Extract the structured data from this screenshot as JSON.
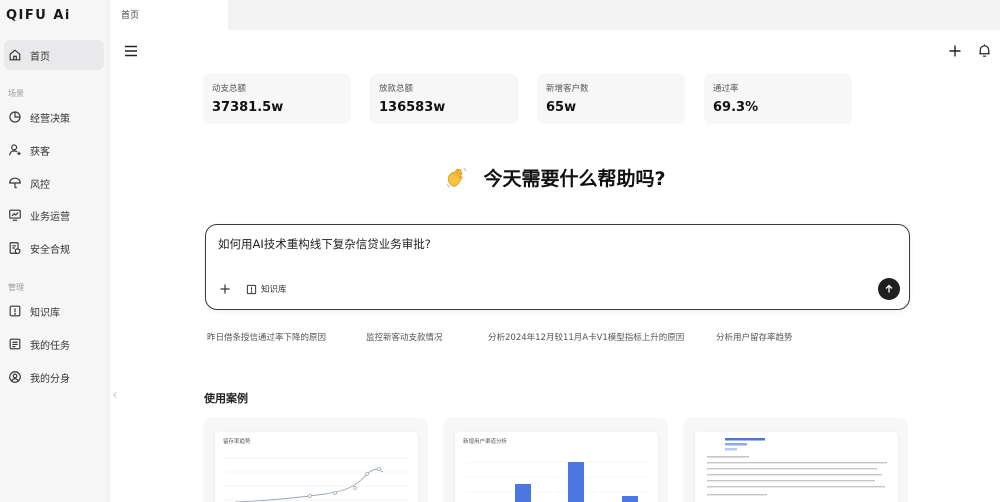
{
  "app": {
    "logo": "QIFU Ai"
  },
  "sidebar": {
    "home": "首页",
    "section_scene": "场景",
    "section_manage": "管理",
    "items_scene": [
      {
        "label": "经营决策",
        "icon": "pie-chart-icon"
      },
      {
        "label": "获客",
        "icon": "user-add-icon"
      },
      {
        "label": "风控",
        "icon": "umbrella-icon"
      },
      {
        "label": "业务运营",
        "icon": "monitor-chart-icon"
      },
      {
        "label": "安全合规",
        "icon": "shield-doc-icon"
      }
    ],
    "items_manage": [
      {
        "label": "知识库",
        "icon": "book-icon"
      },
      {
        "label": "我的任务",
        "icon": "task-list-icon"
      },
      {
        "label": "我的分身",
        "icon": "avatar-icon"
      }
    ]
  },
  "tabs": [
    {
      "label": "首页"
    }
  ],
  "stats": [
    {
      "label": "动支总额",
      "value": "37381.5w"
    },
    {
      "label": "放款总额",
      "value": "136583w"
    },
    {
      "label": "新增客户数",
      "value": "65w"
    },
    {
      "label": "通过率",
      "value": "69.3%"
    }
  ],
  "greeting": "今天需要什么帮助吗?",
  "chat": {
    "input_value": "如何用AI技术重构线下复杂信贷业务审批?",
    "knowledge_base_label": "知识库"
  },
  "suggestions": [
    "昨日借条授信通过率下降的原因",
    "监控新客动支款情况",
    "分析2024年12月较11月A卡V1模型指标上升的原因",
    "分析用户留存率趋势"
  ],
  "use_cases": {
    "title": "使用案例",
    "cards": [
      {
        "title": "留存率趋势"
      },
      {
        "title": "新增用户渠道分析"
      },
      {
        "title": ""
      }
    ]
  },
  "colors": {
    "sidebar_bg": "#f6f6f7",
    "card_bg": "#f7f7f8",
    "accent_bar": "#4a77e0",
    "send_button": "#1f1f1f"
  }
}
